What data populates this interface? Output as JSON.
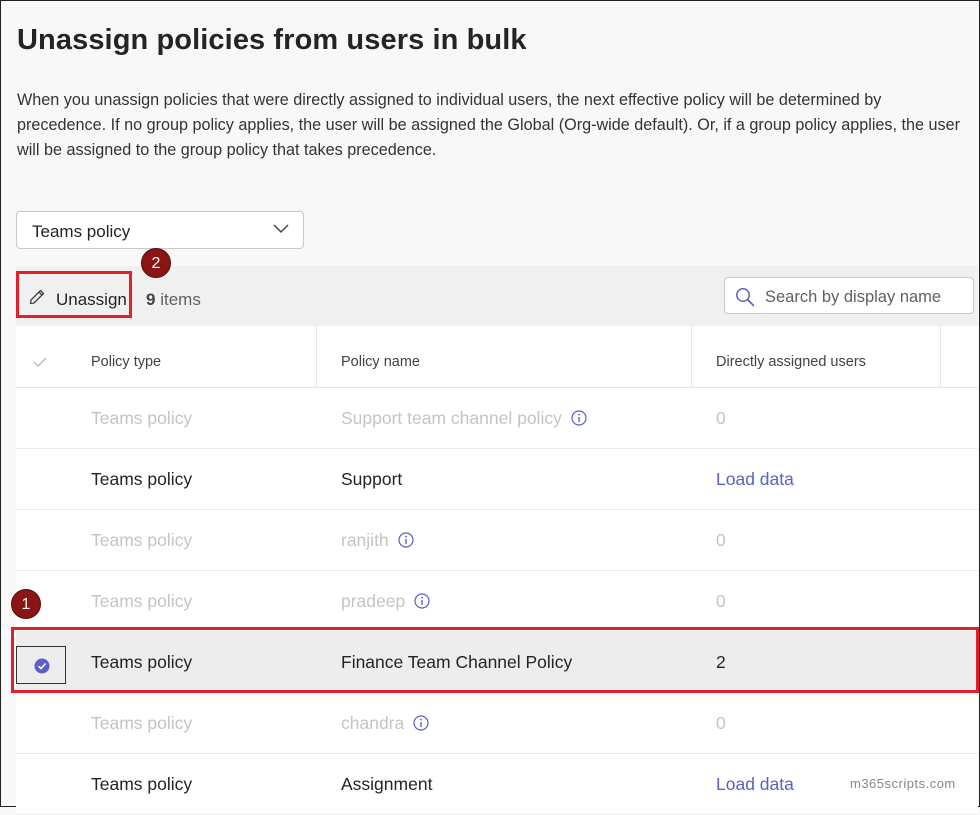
{
  "page": {
    "title": "Unassign policies from users in bulk",
    "description": "When you unassign policies that were directly assigned to individual users, the next effective policy will be determined by precedence. If no group policy applies, the user will be assigned the Global (Org-wide default). Or, if a group policy applies, the user will be assigned to the group policy that takes precedence."
  },
  "policy_dropdown": {
    "value": "Teams policy",
    "icon": "chevron-down-icon"
  },
  "toolbar": {
    "unassign_label": "Unassign",
    "unassign_icon": "pencil-icon",
    "count_number": "9",
    "count_suffix": "items",
    "search_placeholder": "Search by display name",
    "search_icon": "search-icon"
  },
  "annotations": {
    "badge1": "1",
    "badge2": "2",
    "highlight_color": "#e0202b",
    "badge_color": "#8b1414"
  },
  "table": {
    "columns": [
      "Policy type",
      "Policy name",
      "Directly assigned users"
    ],
    "rows": [
      {
        "type": "Teams policy",
        "name": "Support team channel policy",
        "users": "0",
        "state": "dim",
        "info": true
      },
      {
        "type": "Teams policy",
        "name": "Support",
        "users": "Load data",
        "state": "active",
        "link": true
      },
      {
        "type": "Teams policy",
        "name": "ranjith",
        "users": "0",
        "state": "dim",
        "info": true
      },
      {
        "type": "Teams policy",
        "name": "pradeep",
        "users": "0",
        "state": "dim",
        "info": true
      },
      {
        "type": "Teams policy",
        "name": "Finance Team Channel Policy",
        "users": "2",
        "state": "selected"
      },
      {
        "type": "Teams policy",
        "name": "chandra",
        "users": "0",
        "state": "dim",
        "info": true
      },
      {
        "type": "Teams policy",
        "name": "Assignment",
        "users": "Load data",
        "state": "active",
        "link": true
      }
    ]
  },
  "colors": {
    "accent": "#5b5fc7",
    "dim_text": "#c4c4c4"
  },
  "watermark": "m365scripts.com"
}
